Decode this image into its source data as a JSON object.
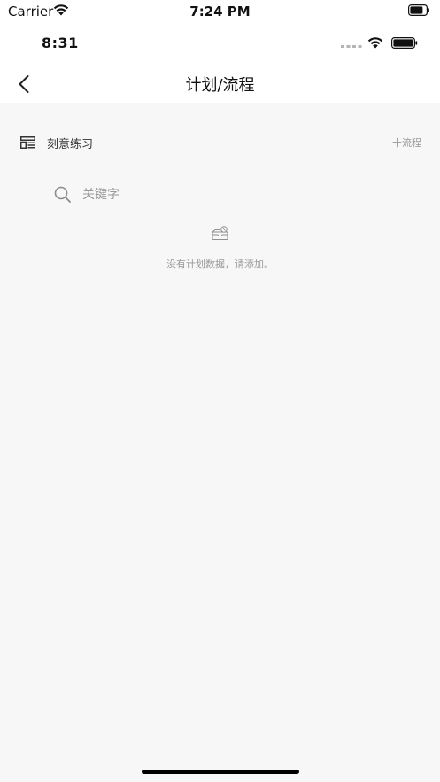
{
  "sim_status": {
    "carrier": "Carrier",
    "time": "7:24 PM",
    "wifi_icon": "wifi-icon",
    "battery_icon": "battery-icon"
  },
  "app_status": {
    "time": "8:31",
    "signal_icon": "signal-dots-icon",
    "wifi_icon": "wifi-icon",
    "battery_icon": "battery-icon"
  },
  "navbar": {
    "back_icon": "chevron-left-icon",
    "title": "计划/流程"
  },
  "section": {
    "icon": "layout-icon",
    "title": "刻意练习",
    "add_label": "十流程"
  },
  "search": {
    "icon": "search-icon",
    "placeholder": "关键字",
    "value": ""
  },
  "empty_state": {
    "icon": "empty-tray-icon",
    "message": "没有计划数据，请添加。"
  },
  "colors": {
    "background": "#f7f7f7",
    "header_background": "#ffffff",
    "muted_text": "#999999"
  }
}
